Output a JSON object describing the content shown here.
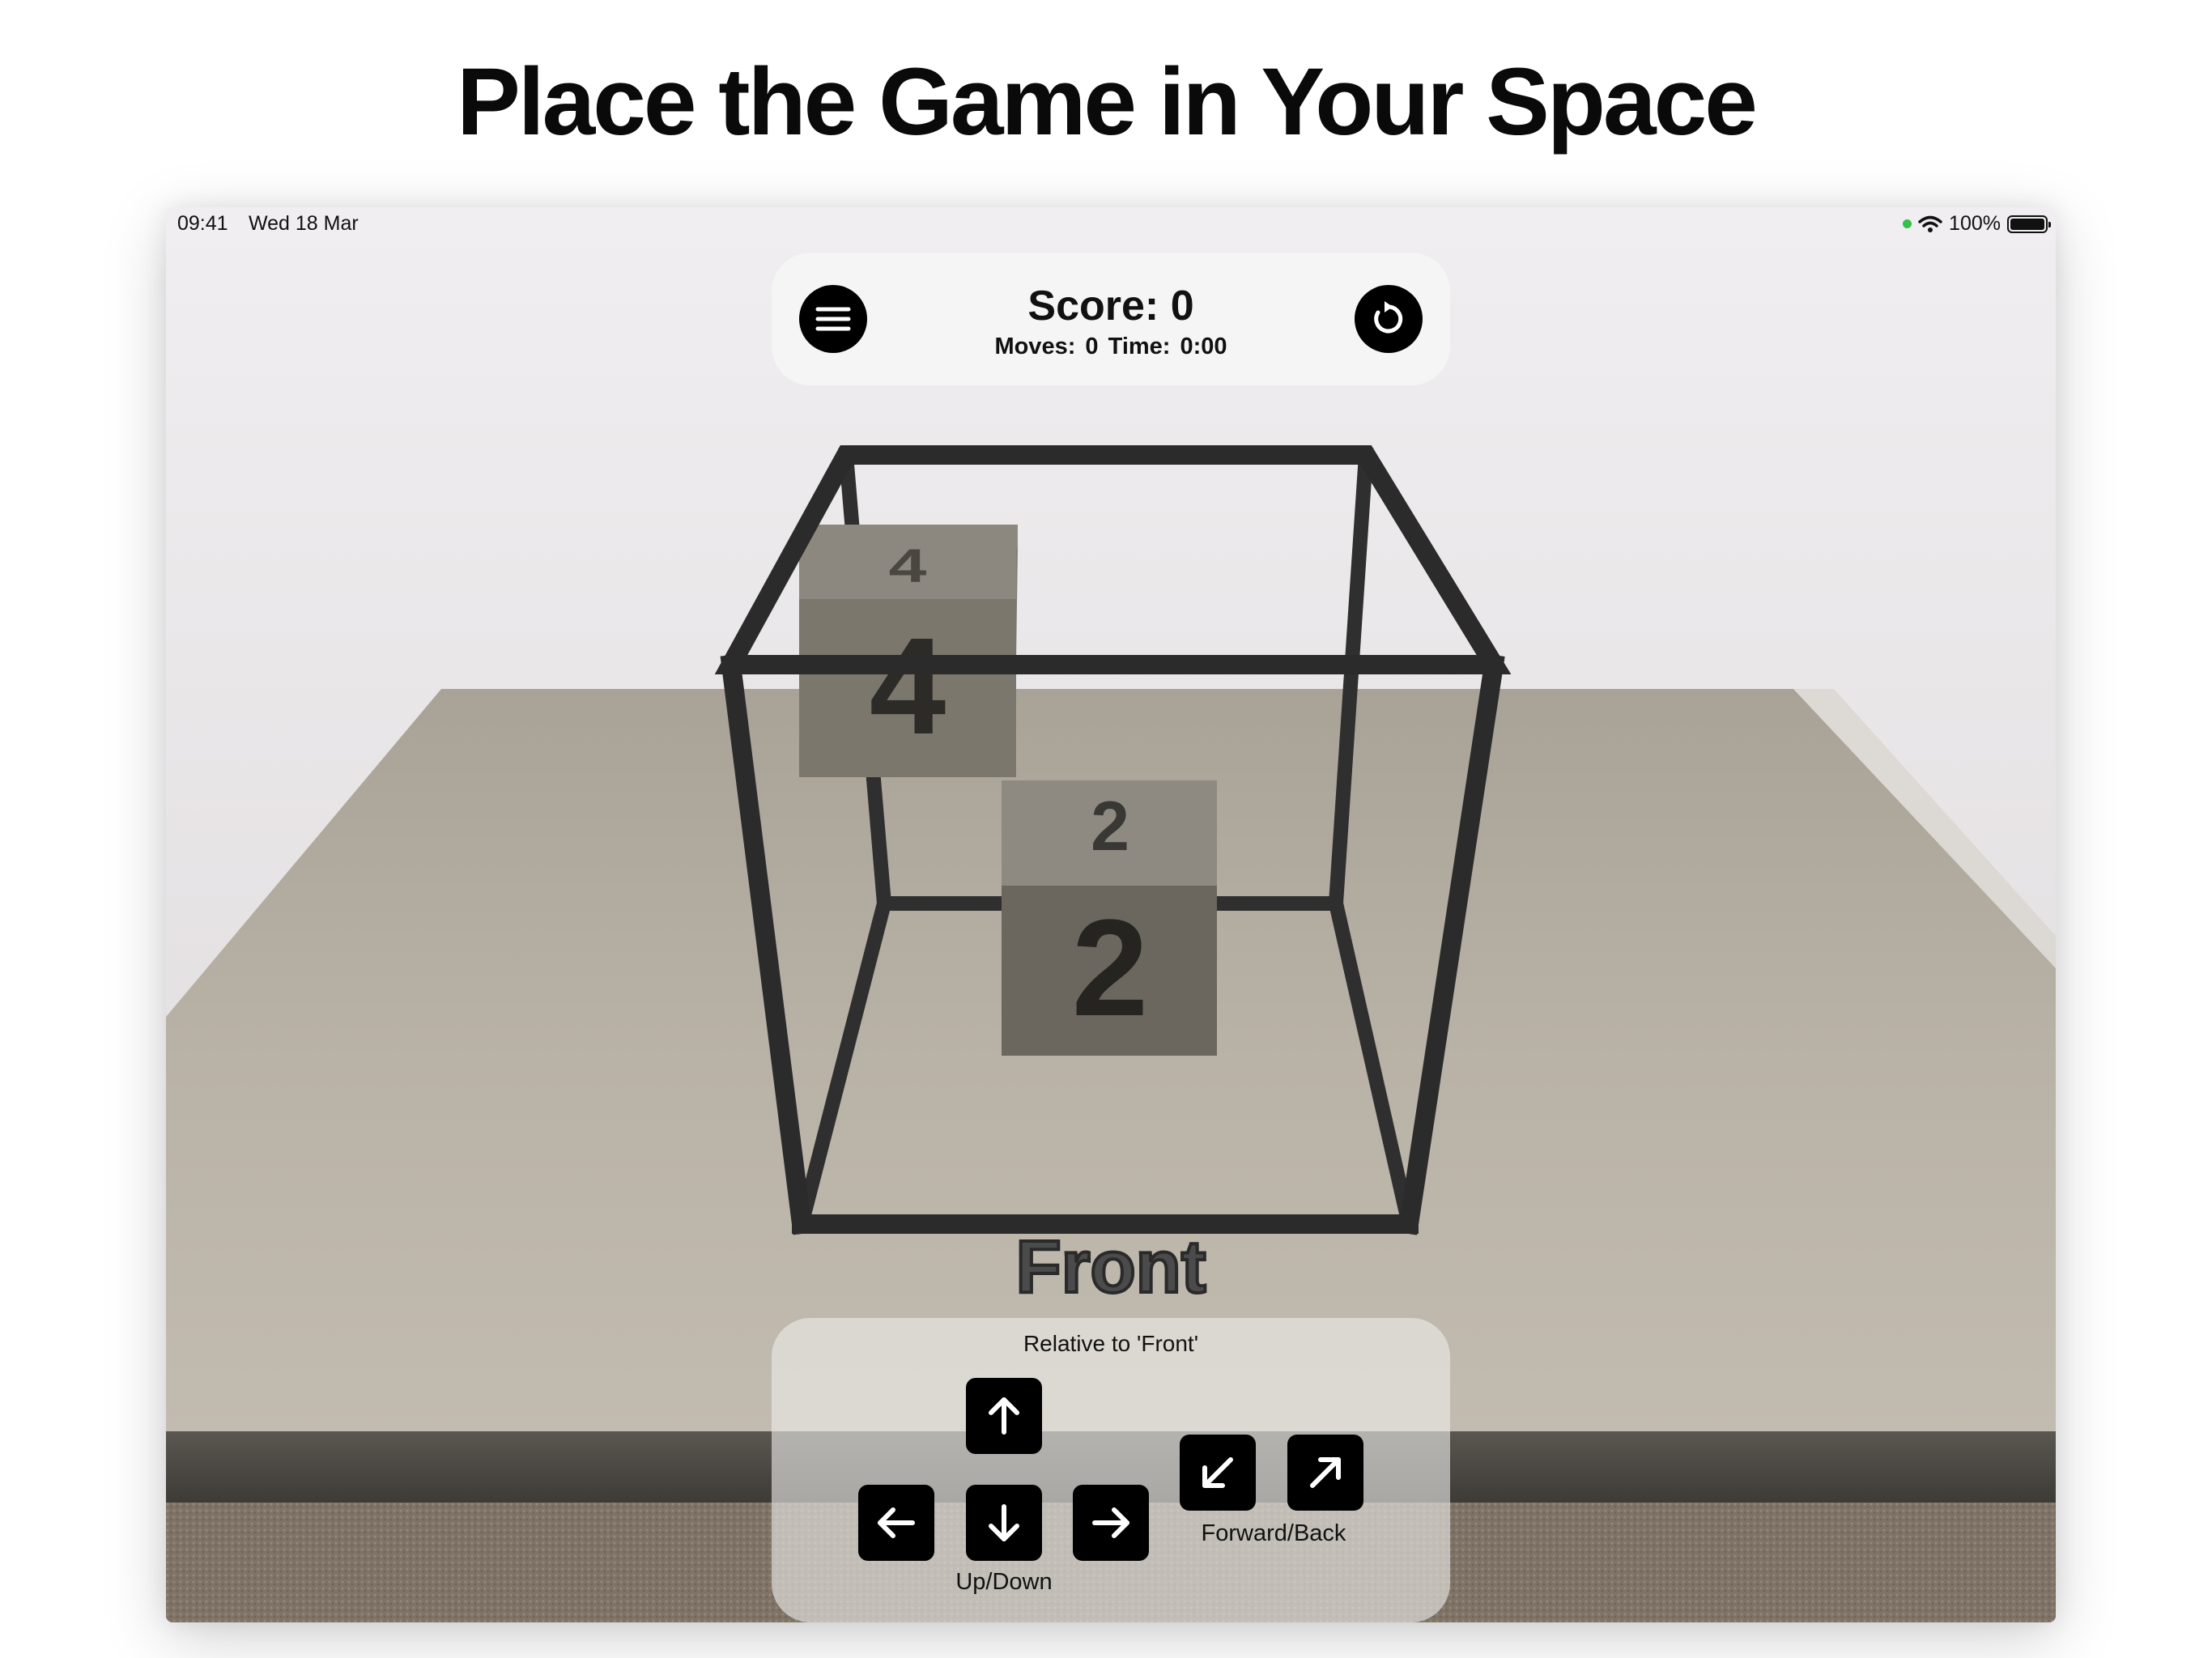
{
  "headline": "Place the Game in Your Space",
  "status_bar": {
    "time": "09:41",
    "date": "Wed 18 Mar",
    "battery": "100%"
  },
  "score_panel": {
    "score_label": "Score:",
    "score_value": "0",
    "moves_label": "Moves:",
    "moves_value": "0",
    "time_label": "Time:",
    "time_value": "0:00"
  },
  "scene": {
    "blocks": [
      {
        "top_number": "4",
        "front_number": "4"
      },
      {
        "top_number": "2",
        "front_number": "2"
      }
    ],
    "front_label": "Front"
  },
  "controls": {
    "relative_label": "Relative to 'Front'",
    "up_down_label": "Up/Down",
    "forward_back_label": "Forward/Back"
  },
  "icons": [
    "menu-icon",
    "reset-icon",
    "arrow-up-icon",
    "arrow-down-icon",
    "arrow-left-icon",
    "arrow-right-icon",
    "arrow-down-left-icon",
    "arrow-up-right-icon",
    "wifi-icon",
    "battery-icon"
  ],
  "colors": {
    "wall": "#e6e3e6",
    "table_top": "#b7b0a4",
    "frame": "#333333",
    "block_light": "#8b8880",
    "block_dark": "#6f6b62",
    "button": "#000000"
  }
}
